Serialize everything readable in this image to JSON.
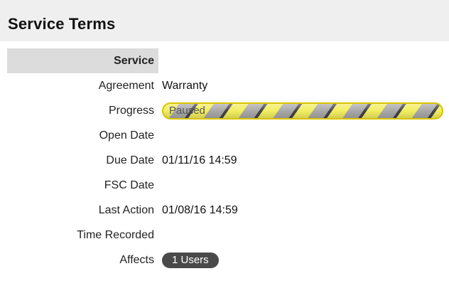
{
  "header": {
    "title": "Service Terms"
  },
  "rows": [
    {
      "label": "Service",
      "value": ""
    },
    {
      "label": "Agreement",
      "value": "Warranty"
    },
    {
      "label": "Progress",
      "value": "Paused"
    },
    {
      "label": "Open Date",
      "value": ""
    },
    {
      "label": "Due Date",
      "value": "01/11/16 14:59"
    },
    {
      "label": "FSC Date",
      "value": ""
    },
    {
      "label": "Last Action",
      "value": "01/08/16 14:59"
    },
    {
      "label": "Time Recorded",
      "value": ""
    },
    {
      "label": "Affects",
      "value": "1 Users"
    }
  ],
  "colors": {
    "header_bg": "#efefef",
    "section_bg": "#dcdcdc",
    "progress_border": "#d9c400",
    "progress_stripe_yellow": "#f2ed60",
    "progress_stripe_gray": "#a8a8a8",
    "badge_bg": "#4a4a4a"
  }
}
